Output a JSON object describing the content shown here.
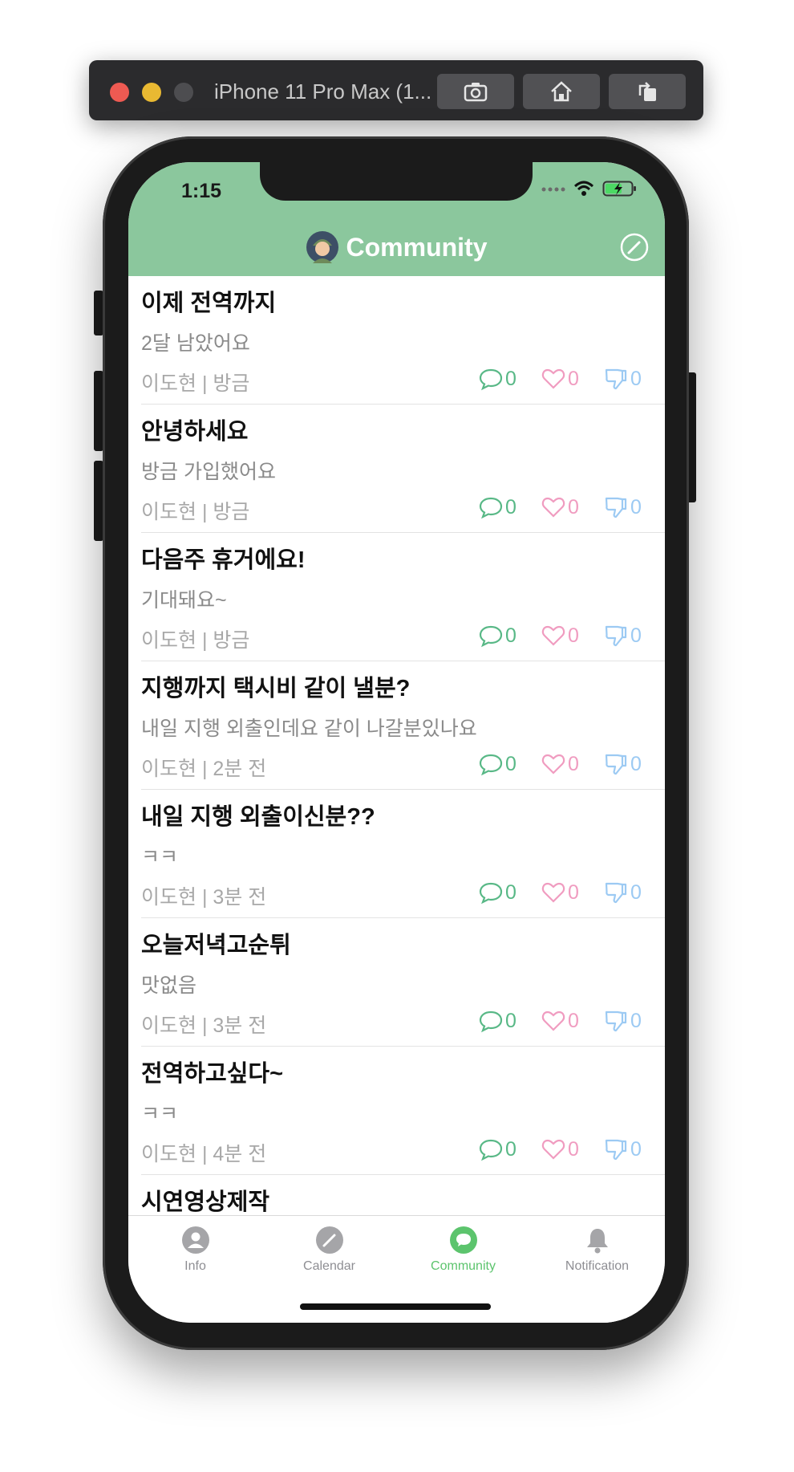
{
  "simulator": {
    "title": "iPhone 11 Pro Max (1...",
    "buttons": [
      "screenshot-icon",
      "home-icon",
      "rotate-icon"
    ]
  },
  "status_bar": {
    "time": "1:15"
  },
  "nav": {
    "title": "Community",
    "avatar_icon": "soldier-avatar-icon",
    "compose_icon": "pencil-circle-icon"
  },
  "posts": [
    {
      "title": "이제 전역까지",
      "body": "2달 남았어요",
      "meta": "이도현 | 방금",
      "comments": "0",
      "likes": "0",
      "dislikes": "0"
    },
    {
      "title": "안녕하세요",
      "body": "방금 가입했어요",
      "meta": "이도현 | 방금",
      "comments": "0",
      "likes": "0",
      "dislikes": "0"
    },
    {
      "title": "다음주 휴거에요!",
      "body": "기대돼요~",
      "meta": "이도현 | 방금",
      "comments": "0",
      "likes": "0",
      "dislikes": "0"
    },
    {
      "title": "지행까지 택시비 같이 낼분?",
      "body": "내일 지행 외출인데요 같이 나갈분있나요",
      "meta": "이도현 | 2분 전",
      "comments": "0",
      "likes": "0",
      "dislikes": "0"
    },
    {
      "title": "내일 지행 외출이신분??",
      "body": "ㅋㅋ",
      "meta": "이도현 | 3분 전",
      "comments": "0",
      "likes": "0",
      "dislikes": "0"
    },
    {
      "title": "오늘저녁고순튀",
      "body": "맛없음",
      "meta": "이도현 | 3분 전",
      "comments": "0",
      "likes": "0",
      "dislikes": "0"
    },
    {
      "title": "전역하고싶다~",
      "body": "ㅋㅋ",
      "meta": "이도현 | 4분 전",
      "comments": "0",
      "likes": "0",
      "dislikes": "0"
    },
    {
      "title": "시연영상제작",
      "body": "",
      "meta": "",
      "comments": "",
      "likes": "",
      "dislikes": ""
    }
  ],
  "tabs": [
    {
      "label": "Info",
      "icon": "person-circle-icon"
    },
    {
      "label": "Calendar",
      "icon": "pencil-circle-icon"
    },
    {
      "label": "Community",
      "icon": "chat-bubble-icon",
      "active": true
    },
    {
      "label": "Notification",
      "icon": "bell-icon"
    }
  ],
  "colors": {
    "header": "#8bc79d",
    "active_tab": "#5cc46d",
    "comment": "#58b886",
    "like": "#f09cc0",
    "dislike": "#9ccaf3"
  }
}
